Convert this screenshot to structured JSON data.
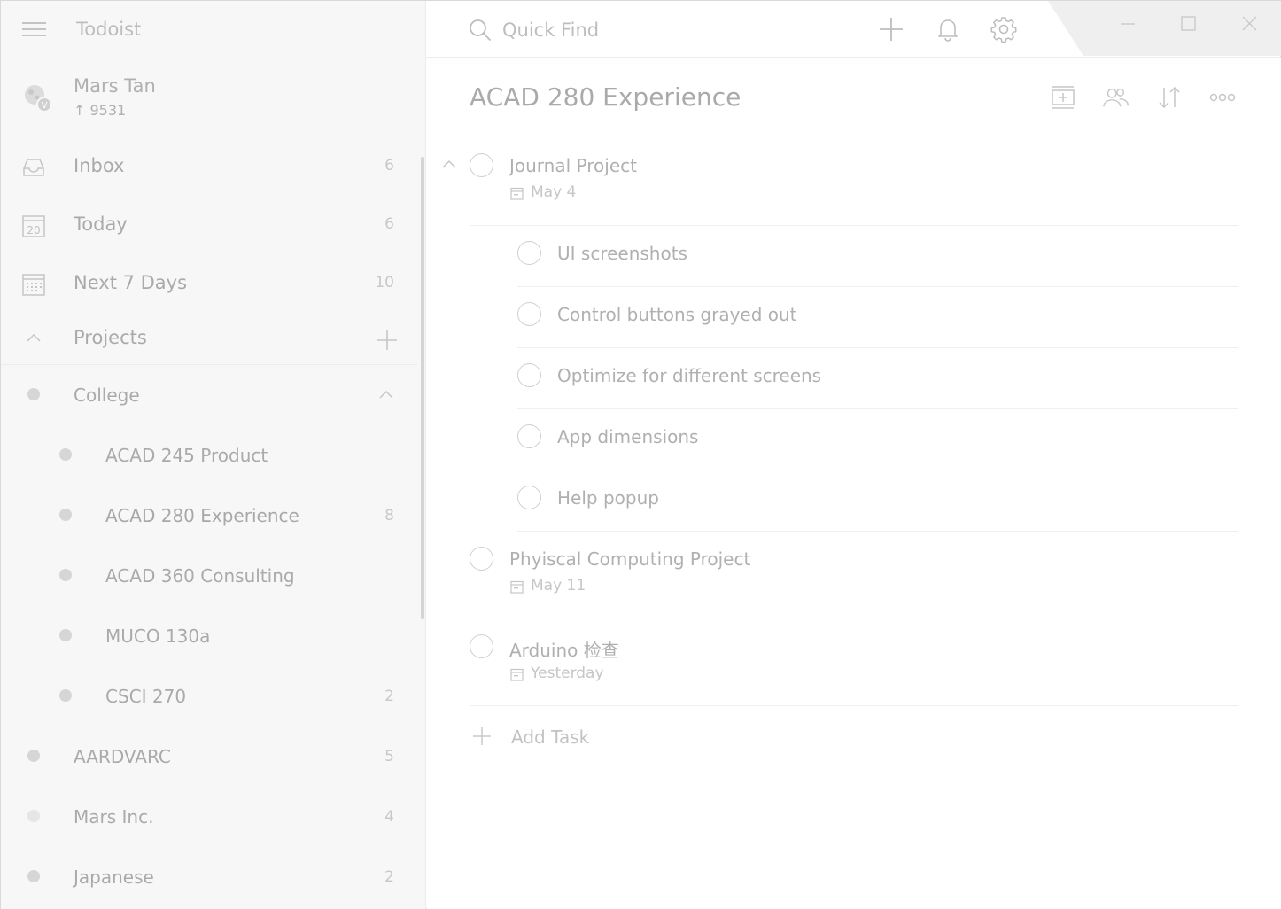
{
  "app": {
    "title": "Todoist"
  },
  "search": {
    "placeholder": "Quick Find"
  },
  "user": {
    "name": "Mars Tan",
    "karma": "↑ 9531"
  },
  "nav": [
    {
      "label": "Inbox",
      "count": "6",
      "icon": "inbox-icon"
    },
    {
      "label": "Today",
      "count": "6",
      "icon": "calendar-today-icon",
      "icon_text": "20"
    },
    {
      "label": "Next 7 Days",
      "count": "10",
      "icon": "calendar-week-icon"
    }
  ],
  "projects_header": {
    "label": "Projects"
  },
  "projects": [
    {
      "name": "College",
      "count": "",
      "indent": 0
    },
    {
      "name": "ACAD 245 Product",
      "count": "",
      "indent": 1
    },
    {
      "name": "ACAD 280 Experience",
      "count": "8",
      "indent": 1,
      "selected": true
    },
    {
      "name": "ACAD 360 Consulting",
      "count": "",
      "indent": 1
    },
    {
      "name": "MUCO 130a",
      "count": "",
      "indent": 1
    },
    {
      "name": "CSCI 270",
      "count": "2",
      "indent": 1
    },
    {
      "name": "AARDVARC",
      "count": "5",
      "indent": 0
    },
    {
      "name": "Mars Inc.",
      "count": "4",
      "indent": 0
    },
    {
      "name": "Japanese",
      "count": "2",
      "indent": 0
    }
  ],
  "main": {
    "title": "ACAD 280 Experience",
    "tasks": [
      {
        "text": "Journal Project",
        "due": "May 4",
        "level": 0
      },
      {
        "text": "UI screenshots",
        "due": "",
        "level": 1
      },
      {
        "text": "Control buttons grayed out",
        "due": "",
        "level": 1
      },
      {
        "text": "Optimize for different screens",
        "due": "",
        "level": 1
      },
      {
        "text": "App dimensions",
        "due": "",
        "level": 1
      },
      {
        "text": "Help popup",
        "due": "",
        "level": 1
      },
      {
        "text": "Phyiscal Computing Project",
        "due": "May 11",
        "level": 0
      },
      {
        "text": "Arduino 检查",
        "due": "Yesterday",
        "level": 0
      }
    ],
    "add_task_label": "Add Task"
  },
  "colors": {
    "sidebar_bg": "#f7f7f7",
    "text": "#b0b0b0",
    "border": "#ececec"
  }
}
